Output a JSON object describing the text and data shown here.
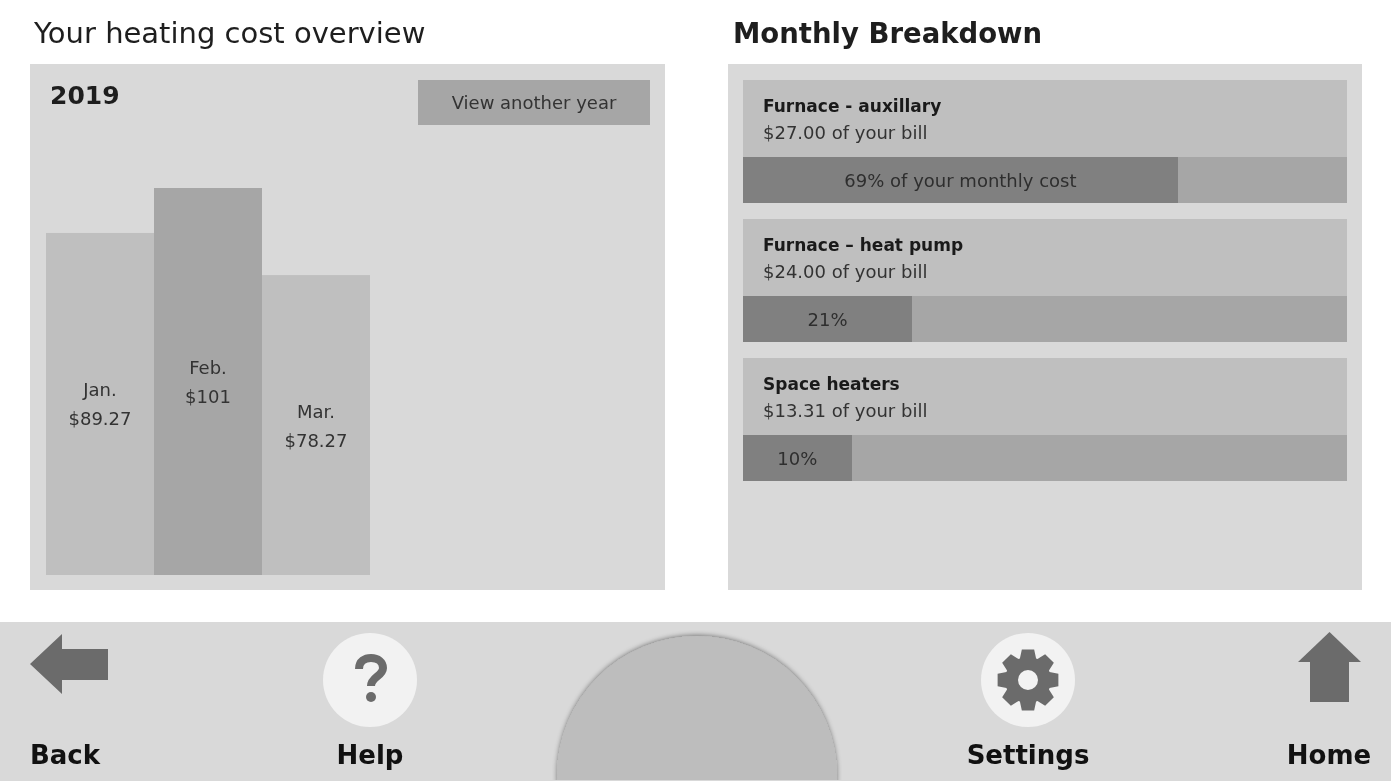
{
  "overview": {
    "title": "Your heating cost overview",
    "year": "2019",
    "year_button": "View another year",
    "chart_data": [
      {
        "type": "bar",
        "categories": [
          "Jan.",
          "Feb.",
          "Mar."
        ],
        "values": [
          89.27,
          101,
          78.27
        ],
        "colors": [
          "#bfbfbf",
          "#a6a6a6",
          "#bfbfbf"
        ],
        "value_labels": [
          "$89.27",
          "$101",
          "$78.27"
        ]
      }
    ]
  },
  "breakdown": {
    "title": "Monthly Breakdown",
    "items": [
      {
        "name": "Furnace - auxillary",
        "amount": "$27.00 of your bill",
        "level": 0.72,
        "reading": "69% of your monthly cost"
      },
      {
        "name": "Furnace – heat pump",
        "amount": "$24.00 of your bill",
        "level": 0.28,
        "reading": "21%"
      },
      {
        "name": "Space heaters",
        "amount": "$13.31 of your bill",
        "level": 0.18,
        "reading": "10%"
      }
    ]
  },
  "nav": [
    {
      "kind": "back",
      "label": "Back"
    },
    {
      "kind": "help",
      "label": "Help"
    },
    {
      "kind": "dial"
    },
    {
      "kind": "settings",
      "label": "Settings"
    },
    {
      "kind": "home",
      "label": "Home"
    }
  ]
}
